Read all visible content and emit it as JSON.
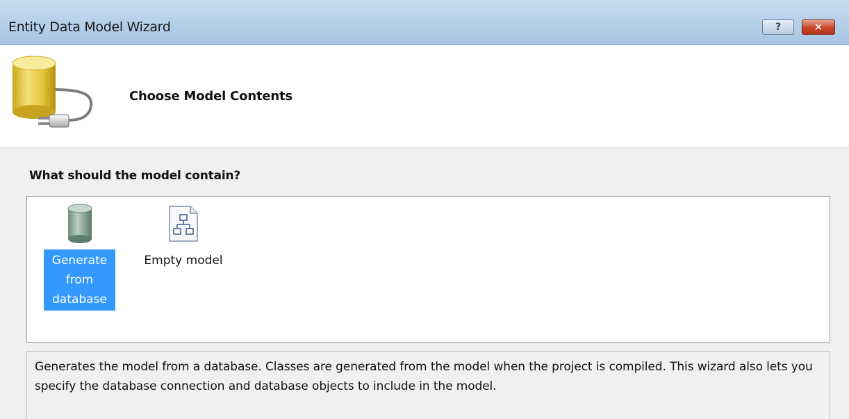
{
  "window": {
    "title": "Entity Data Model Wizard",
    "help_label": "?",
    "close_label": "✕"
  },
  "header": {
    "title": "Choose Model Contents"
  },
  "main": {
    "question": "What should the model contain?",
    "items": [
      {
        "label": "Generate from database",
        "selected": true,
        "icon": "database-icon"
      },
      {
        "label": "Empty model",
        "selected": false,
        "icon": "empty-model-icon"
      }
    ],
    "description": "Generates the model from a database. Classes are generated from the model when the project is compiled. This wizard also lets you specify the database connection and database objects to include in the model."
  },
  "colors": {
    "selection": "#3399ff",
    "titlebar": "#b7d0ea",
    "close_button": "#c8452b"
  }
}
